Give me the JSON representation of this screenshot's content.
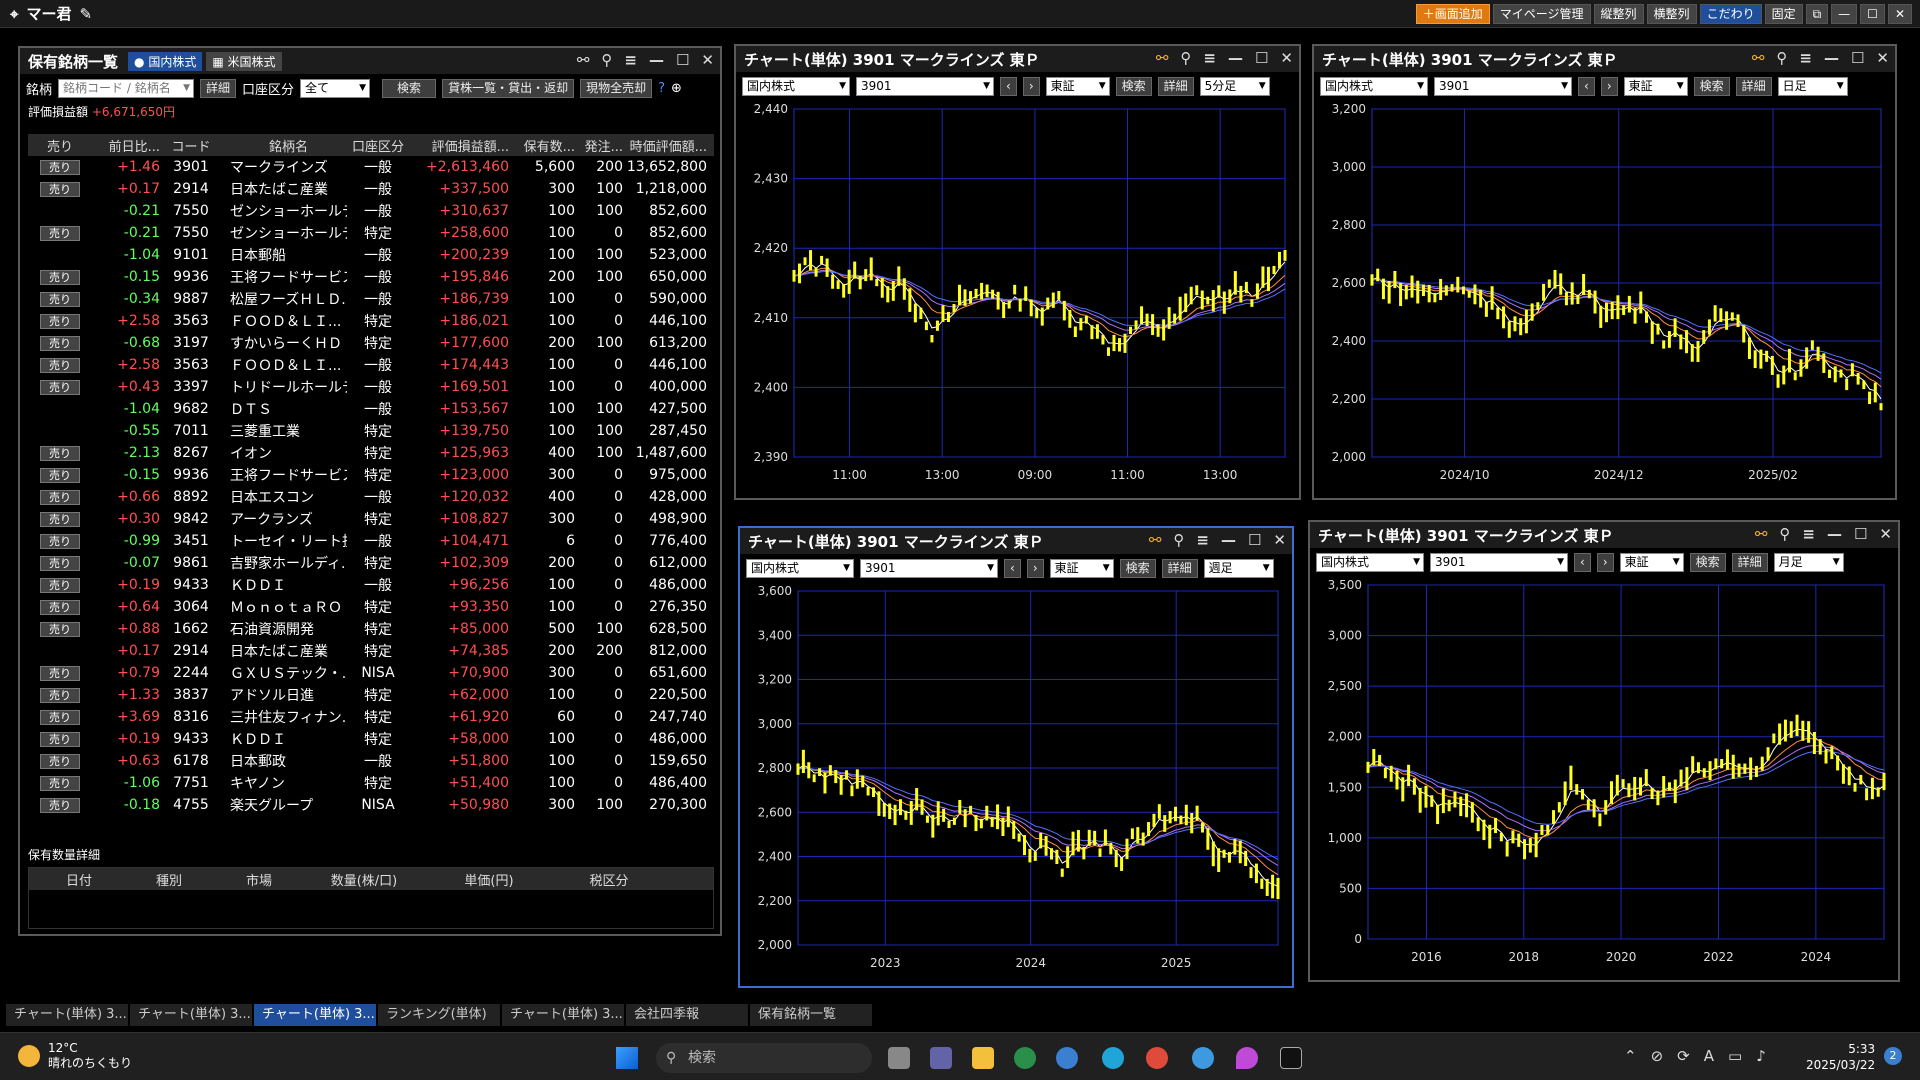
{
  "app": {
    "title": "マー君"
  },
  "topbar": {
    "buttons": [
      "＋画面追加",
      "マイページ管理",
      "縦整列",
      "横整列",
      "こだわり",
      "固定"
    ]
  },
  "holdings": {
    "title": "保有銘柄一覧",
    "tab_jp": "国内株式",
    "tab_us": "米国株式",
    "filter_label": "銘柄",
    "filter_placeholder": "銘柄コード / 銘柄名",
    "detail": "詳細",
    "acct_label": "口座区分",
    "acct_value": "全て",
    "search": "検索",
    "lend": "貸株一覧・貸出・返却",
    "sell_all": "現物全売却",
    "pl_label": "評価損益額",
    "pl_value": "+6,671,650円",
    "headers": [
      "売り",
      "前日比...",
      "コード",
      "銘柄名",
      "口座区分",
      "評価損益額...",
      "保有数...",
      "発注...",
      "時価評価額..."
    ],
    "sell_label": "売り",
    "rows": [
      {
        "sell": true,
        "chg": "+1.46",
        "code": "3901",
        "name": "マークラインズ",
        "acct": "一般",
        "pl": "+2,613,460",
        "qty": "5,600",
        "ord": "200",
        "mv": "13,652,800"
      },
      {
        "sell": true,
        "chg": "+0.17",
        "code": "2914",
        "name": "日本たばこ産業",
        "acct": "一般",
        "pl": "+337,500",
        "qty": "300",
        "ord": "100",
        "mv": "1,218,000"
      },
      {
        "sell": false,
        "chg": "-0.21",
        "code": "7550",
        "name": "ゼンショーホールデ...",
        "acct": "一般",
        "pl": "+310,637",
        "qty": "100",
        "ord": "100",
        "mv": "852,600"
      },
      {
        "sell": true,
        "chg": "-0.21",
        "code": "7550",
        "name": "ゼンショーホールデ...",
        "acct": "特定",
        "pl": "+258,600",
        "qty": "100",
        "ord": "0",
        "mv": "852,600"
      },
      {
        "sell": false,
        "chg": "-1.04",
        "code": "9101",
        "name": "日本郵船",
        "acct": "一般",
        "pl": "+200,239",
        "qty": "100",
        "ord": "100",
        "mv": "523,000"
      },
      {
        "sell": true,
        "chg": "-0.15",
        "code": "9936",
        "name": "王将フードサービス",
        "acct": "一般",
        "pl": "+195,846",
        "qty": "200",
        "ord": "100",
        "mv": "650,000"
      },
      {
        "sell": true,
        "chg": "-0.34",
        "code": "9887",
        "name": "松屋フーズＨＬＤ...",
        "acct": "一般",
        "pl": "+186,739",
        "qty": "100",
        "ord": "0",
        "mv": "590,000"
      },
      {
        "sell": true,
        "chg": "+2.58",
        "code": "3563",
        "name": "ＦＯＯＤ＆ＬＩ...",
        "acct": "特定",
        "pl": "+186,021",
        "qty": "100",
        "ord": "0",
        "mv": "446,100"
      },
      {
        "sell": true,
        "chg": "-0.68",
        "code": "3197",
        "name": "すかいらーくＨＤ",
        "acct": "特定",
        "pl": "+177,600",
        "qty": "200",
        "ord": "100",
        "mv": "613,200"
      },
      {
        "sell": true,
        "chg": "+2.58",
        "code": "3563",
        "name": "ＦＯＯＤ＆ＬＩ...",
        "acct": "一般",
        "pl": "+174,443",
        "qty": "100",
        "ord": "0",
        "mv": "446,100"
      },
      {
        "sell": true,
        "chg": "+0.43",
        "code": "3397",
        "name": "トリドールホールデ...",
        "acct": "一般",
        "pl": "+169,501",
        "qty": "100",
        "ord": "0",
        "mv": "400,000"
      },
      {
        "sell": false,
        "chg": "-1.04",
        "code": "9682",
        "name": "ＤＴＳ",
        "acct": "一般",
        "pl": "+153,567",
        "qty": "100",
        "ord": "100",
        "mv": "427,500"
      },
      {
        "sell": false,
        "chg": "-0.55",
        "code": "7011",
        "name": "三菱重工業",
        "acct": "特定",
        "pl": "+139,750",
        "qty": "100",
        "ord": "100",
        "mv": "287,450"
      },
      {
        "sell": true,
        "chg": "-2.13",
        "code": "8267",
        "name": "イオン",
        "acct": "特定",
        "pl": "+125,963",
        "qty": "400",
        "ord": "100",
        "mv": "1,487,600"
      },
      {
        "sell": true,
        "chg": "-0.15",
        "code": "9936",
        "name": "王将フードサービス",
        "acct": "特定",
        "pl": "+123,000",
        "qty": "300",
        "ord": "0",
        "mv": "975,000"
      },
      {
        "sell": true,
        "chg": "+0.66",
        "code": "8892",
        "name": "日本エスコン",
        "acct": "一般",
        "pl": "+120,032",
        "qty": "400",
        "ord": "0",
        "mv": "428,000"
      },
      {
        "sell": true,
        "chg": "+0.30",
        "code": "9842",
        "name": "アークランズ",
        "acct": "特定",
        "pl": "+108,827",
        "qty": "300",
        "ord": "0",
        "mv": "498,900"
      },
      {
        "sell": true,
        "chg": "-0.99",
        "code": "3451",
        "name": "トーセイ・リート投...",
        "acct": "一般",
        "pl": "+104,471",
        "qty": "6",
        "ord": "0",
        "mv": "776,400"
      },
      {
        "sell": true,
        "chg": "-0.07",
        "code": "9861",
        "name": "吉野家ホールディ...",
        "acct": "特定",
        "pl": "+102,309",
        "qty": "200",
        "ord": "0",
        "mv": "612,000"
      },
      {
        "sell": true,
        "chg": "+0.19",
        "code": "9433",
        "name": "ＫＤＤＩ",
        "acct": "一般",
        "pl": "+96,256",
        "qty": "100",
        "ord": "0",
        "mv": "486,000"
      },
      {
        "sell": true,
        "chg": "+0.64",
        "code": "3064",
        "name": "ＭｏｎｏｔａＲＯ",
        "acct": "特定",
        "pl": "+93,350",
        "qty": "100",
        "ord": "0",
        "mv": "276,350"
      },
      {
        "sell": true,
        "chg": "+0.88",
        "code": "1662",
        "name": "石油資源開発",
        "acct": "特定",
        "pl": "+85,000",
        "qty": "500",
        "ord": "100",
        "mv": "628,500"
      },
      {
        "sell": false,
        "chg": "+0.17",
        "code": "2914",
        "name": "日本たばこ産業",
        "acct": "特定",
        "pl": "+74,385",
        "qty": "200",
        "ord": "200",
        "mv": "812,000"
      },
      {
        "sell": true,
        "chg": "+0.79",
        "code": "2244",
        "name": "ＧＸＵＳテック・...",
        "acct": "NISA",
        "pl": "+70,900",
        "qty": "300",
        "ord": "0",
        "mv": "651,600"
      },
      {
        "sell": true,
        "chg": "+1.33",
        "code": "3837",
        "name": "アドソル日進",
        "acct": "特定",
        "pl": "+62,000",
        "qty": "100",
        "ord": "0",
        "mv": "220,500"
      },
      {
        "sell": true,
        "chg": "+3.69",
        "code": "8316",
        "name": "三井住友フィナン...",
        "acct": "特定",
        "pl": "+61,920",
        "qty": "60",
        "ord": "0",
        "mv": "247,740"
      },
      {
        "sell": true,
        "chg": "+0.19",
        "code": "9433",
        "name": "ＫＤＤＩ",
        "acct": "特定",
        "pl": "+58,000",
        "qty": "100",
        "ord": "0",
        "mv": "486,000"
      },
      {
        "sell": true,
        "chg": "+0.63",
        "code": "6178",
        "name": "日本郵政",
        "acct": "一般",
        "pl": "+51,800",
        "qty": "100",
        "ord": "0",
        "mv": "159,650"
      },
      {
        "sell": true,
        "chg": "-1.06",
        "code": "7751",
        "name": "キヤノン",
        "acct": "特定",
        "pl": "+51,400",
        "qty": "100",
        "ord": "0",
        "mv": "486,400"
      },
      {
        "sell": true,
        "chg": "-0.18",
        "code": "4755",
        "name": "楽天グループ",
        "acct": "NISA",
        "pl": "+50,980",
        "qty": "300",
        "ord": "100",
        "mv": "270,300"
      }
    ],
    "detail_title": "保有数量詳細",
    "detail_headers": [
      "日付",
      "種別",
      "市場",
      "数量(株/口)",
      "単価(円)",
      "税区分"
    ]
  },
  "charts": [
    {
      "title": "チャート(単体) 3901 マークラインズ 東Ｐ",
      "market": "国内株式",
      "code": "3901",
      "exch": "東証",
      "search": "検索",
      "detail": "詳細",
      "period": "5分足"
    },
    {
      "title": "チャート(単体) 3901 マークラインズ 東Ｐ",
      "market": "国内株式",
      "code": "3901",
      "exch": "東証",
      "search": "検索",
      "detail": "詳細",
      "period": "日足"
    },
    {
      "title": "チャート(単体) 3901 マークラインズ 東Ｐ",
      "market": "国内株式",
      "code": "3901",
      "exch": "東証",
      "search": "検索",
      "detail": "詳細",
      "period": "週足"
    },
    {
      "title": "チャート(単体) 3901 マークラインズ 東Ｐ",
      "market": "国内株式",
      "code": "3901",
      "exch": "東証",
      "search": "検索",
      "detail": "詳細",
      "period": "月足"
    }
  ],
  "chart_data": [
    {
      "type": "line",
      "yticks": [
        "2,440",
        "2,430",
        "2,420",
        "2,410",
        "2,400",
        "2,390"
      ],
      "xticks": [
        "11:00",
        "13:00",
        "09:00",
        "11:00",
        "13:00"
      ],
      "ylim": [
        2390,
        2440
      ]
    },
    {
      "type": "line",
      "yticks": [
        "3,200",
        "3,000",
        "2,800",
        "2,600",
        "2,400",
        "2,200",
        "2,000"
      ],
      "xticks": [
        "2024/10",
        "2024/12",
        "2025/02"
      ],
      "ylim": [
        2000,
        3200
      ]
    },
    {
      "type": "line",
      "yticks": [
        "3,600",
        "3,400",
        "3,200",
        "3,000",
        "2,800",
        "2,600",
        "2,400",
        "2,200",
        "2,000"
      ],
      "xticks": [
        "2023",
        "2024",
        "2025"
      ],
      "ylim": [
        2000,
        3600
      ]
    },
    {
      "type": "line",
      "yticks": [
        "3,500",
        "3,000",
        "2,500",
        "2,000",
        "1,500",
        "1,000",
        "500",
        "0"
      ],
      "xticks": [
        "2016",
        "2018",
        "2020",
        "2022",
        "2024"
      ],
      "ylim": [
        0,
        3500
      ]
    }
  ],
  "bottom_tabs": [
    "チャート(単体) 3...",
    "チャート(単体) 3...",
    "チャート(単体) 3...",
    "ランキング(単体)",
    "チャート(単体) 3...",
    "会社四季報",
    "保有銘柄一覧"
  ],
  "taskbar": {
    "temp": "12°C",
    "weather": "晴れのちくもり",
    "search": "検索",
    "time": "5:33",
    "date": "2025/03/22",
    "badge": "2"
  }
}
